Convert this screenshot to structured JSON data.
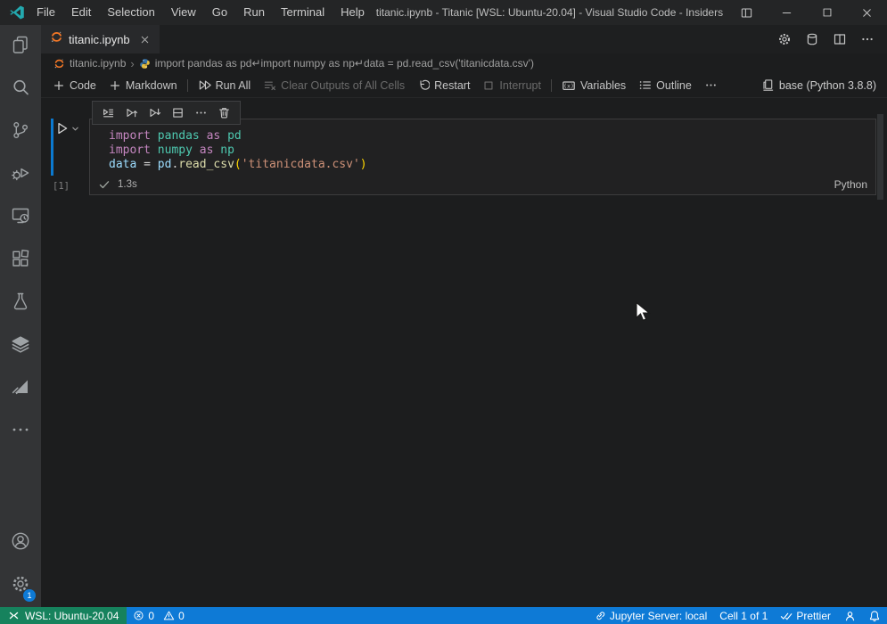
{
  "titlebar": {
    "menus": [
      "File",
      "Edit",
      "Selection",
      "View",
      "Go",
      "Run",
      "Terminal",
      "Help"
    ],
    "window_title": "titanic.ipynb - Titanic [WSL: Ubuntu-20.04] - Visual Studio Code - Insiders"
  },
  "tab": {
    "label": "titanic.ipynb"
  },
  "tab_actions": [
    {
      "icon": "gear",
      "name": "gear-icon"
    },
    {
      "icon": "database",
      "name": "database-icon"
    },
    {
      "icon": "split-editor",
      "name": "split-editor-icon"
    },
    {
      "icon": "ellipsis",
      "name": "more-actions-icon"
    }
  ],
  "breadcrumb": {
    "file": "titanic.ipynb",
    "separator": "›",
    "cell_preview": "import pandas as pd↵import numpy as np↵data = pd.read_csv('titanicdata.csv')"
  },
  "toolbar": {
    "add_code": "Code",
    "add_markdown": "Markdown",
    "run_all": "Run All",
    "clear_outputs": "Clear Outputs of All Cells",
    "restart": "Restart",
    "interrupt": "Interrupt",
    "variables": "Variables",
    "outline": "Outline",
    "kernel_label": "base (Python 3.8.8)"
  },
  "activity_bar": {
    "top": [
      {
        "icon": "explorer",
        "name": "explorer-icon"
      },
      {
        "icon": "search",
        "name": "search-icon"
      },
      {
        "icon": "source-control",
        "name": "source-control-icon"
      },
      {
        "icon": "run-debug",
        "name": "run-and-debug-icon"
      },
      {
        "icon": "remote-explorer",
        "name": "remote-explorer-icon"
      },
      {
        "icon": "extensions",
        "name": "extensions-icon"
      },
      {
        "icon": "testing",
        "name": "testing-flask-icon"
      },
      {
        "icon": "layers",
        "name": "layers-icon"
      },
      {
        "icon": "send",
        "name": "send-icon"
      },
      {
        "icon": "more",
        "name": "more-views-icon"
      }
    ],
    "bottom": [
      {
        "icon": "account",
        "name": "account-icon"
      },
      {
        "icon": "gear-large",
        "name": "settings-gear-icon",
        "badge": "1"
      }
    ]
  },
  "cell_toolbar": {
    "icons": [
      {
        "icon": "run-by-line",
        "name": "run-by-line-icon"
      },
      {
        "icon": "run-above",
        "name": "execute-above-cells-icon"
      },
      {
        "icon": "run-below",
        "name": "execute-cell-and-below-icon"
      },
      {
        "icon": "split-cell",
        "name": "split-cell-icon"
      },
      {
        "icon": "ellipsis",
        "name": "more-cell-actions-icon"
      },
      {
        "icon": "trash",
        "name": "delete-cell-icon"
      }
    ]
  },
  "cell": {
    "execution_count": "[1]",
    "duration": "1.3s",
    "language": "Python",
    "code_lines": [
      {
        "tokens": [
          {
            "t": "import",
            "c": "#C586C0"
          },
          {
            "t": " ",
            "c": ""
          },
          {
            "t": "pandas",
            "c": "#4EC9B0"
          },
          {
            "t": " ",
            "c": ""
          },
          {
            "t": "as",
            "c": "#C586C0"
          },
          {
            "t": " ",
            "c": ""
          },
          {
            "t": "pd",
            "c": "#4EC9B0"
          }
        ]
      },
      {
        "tokens": [
          {
            "t": "import",
            "c": "#C586C0"
          },
          {
            "t": " ",
            "c": ""
          },
          {
            "t": "numpy",
            "c": "#4EC9B0"
          },
          {
            "t": " ",
            "c": ""
          },
          {
            "t": "as",
            "c": "#C586C0"
          },
          {
            "t": " ",
            "c": ""
          },
          {
            "t": "np",
            "c": "#4EC9B0"
          }
        ]
      },
      {
        "tokens": [
          {
            "t": "data",
            "c": "#9CDCFE"
          },
          {
            "t": " = ",
            "c": "#D4D4D4"
          },
          {
            "t": "pd",
            "c": "#9CDCFE"
          },
          {
            "t": ".",
            "c": "#D4D4D4"
          },
          {
            "t": "read_csv",
            "c": "#DCDCAA"
          },
          {
            "t": "(",
            "c": "#FFD700"
          },
          {
            "t": "'titanicdata.csv'",
            "c": "#CE9178"
          },
          {
            "t": ")",
            "c": "#FFD700"
          }
        ]
      }
    ]
  },
  "statusbar": {
    "remote_label": "WSL: Ubuntu-20.04",
    "error_count": "0",
    "warning_count": "0",
    "jupyter_server": "Jupyter Server: local",
    "cell_position": "Cell 1 of 1",
    "prettier_label": "Prettier"
  },
  "icons": {
    "vscode-insiders-logo": "teal vscode ribbon",
    "jupyter-notebook-icon": "orange double crescent",
    "python-icon": "blue-yellow snakes",
    "layout-icon": "window layout pane",
    "minimize-icon": "horizontal line",
    "maximize-icon": "square outline",
    "close-icon": "x cross",
    "gear-icon": "cog",
    "database-icon": "cylinder",
    "split-editor-icon": "rect with vertical divider",
    "more-actions-icon": "ellipsis dots",
    "plus-icon": "+",
    "run-all-icon": "double play triangles",
    "clear-outputs-icon": "lines with x",
    "restart-icon": "circular arrow",
    "interrupt-icon": "stop square",
    "variables-icon": "box with (x)",
    "outline-icon": "bulleted list",
    "kernel-icon": "server jug",
    "run-cell-icon": "play triangle",
    "chevron-down-icon": "v chevron",
    "success-check-icon": "checkmark",
    "remote-icon": "greater-less brackets",
    "error-icon": "circle with x",
    "warning-icon": "triangle with !",
    "link-icon": "chain link",
    "check-all-icon": "double checkmark",
    "feedback-icon": "person silhouette",
    "bell-icon": "notification bell",
    "trash-icon": "trash bin",
    "split-cell-icon": "rect with horizontal divider"
  },
  "colors": {
    "statusbar_blue": "#0E7AD6",
    "remote_green": "#16825D",
    "focus_bar_blue": "#0b79d0",
    "jupyter_orange": "#F37726",
    "editor_bg": "#1c1d1e"
  }
}
